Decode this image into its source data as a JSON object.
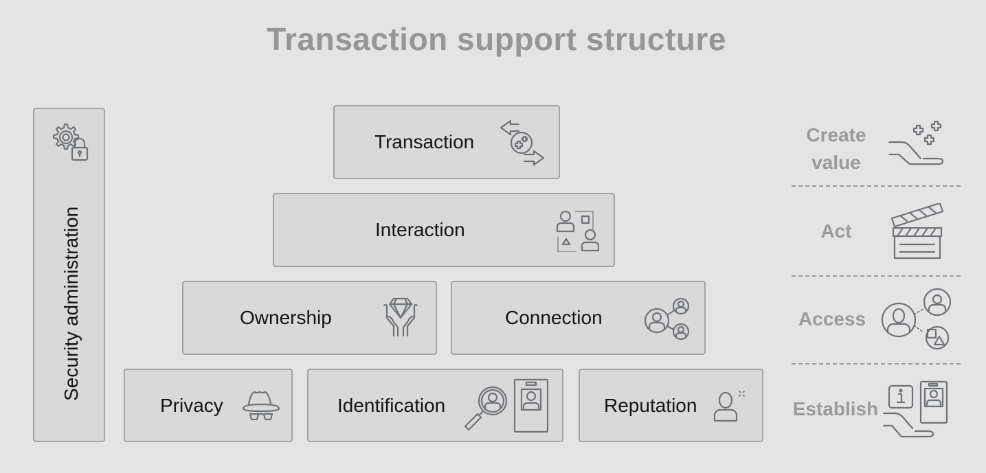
{
  "title": "Transaction support structure",
  "side_column": {
    "label": "Security administration",
    "icon": "gear-lock-icon"
  },
  "pyramid": {
    "transaction": {
      "label": "Transaction",
      "icon": "exchange-value-icon"
    },
    "interaction": {
      "label": "Interaction",
      "icon": "people-shapes-icon"
    },
    "ownership": {
      "label": "Ownership",
      "icon": "hands-diamond-icon"
    },
    "connection": {
      "label": "Connection",
      "icon": "user-network-icon"
    },
    "privacy": {
      "label": "Privacy",
      "icon": "incognito-icon"
    },
    "identification": {
      "label": "Identification",
      "icon": "magnifier-user-badge-icon"
    },
    "reputation": {
      "label": "Reputation",
      "icon": "user-sparkle-icon"
    }
  },
  "stages": [
    {
      "label_line1": "Create",
      "label_line2": "value",
      "icon": "hand-plus-icon"
    },
    {
      "label": "Act",
      "icon": "clapperboard-icon"
    },
    {
      "label": "Access",
      "icon": "user-access-network-icon"
    },
    {
      "label": "Establish",
      "icon": "hand-info-badge-icon"
    }
  ]
}
